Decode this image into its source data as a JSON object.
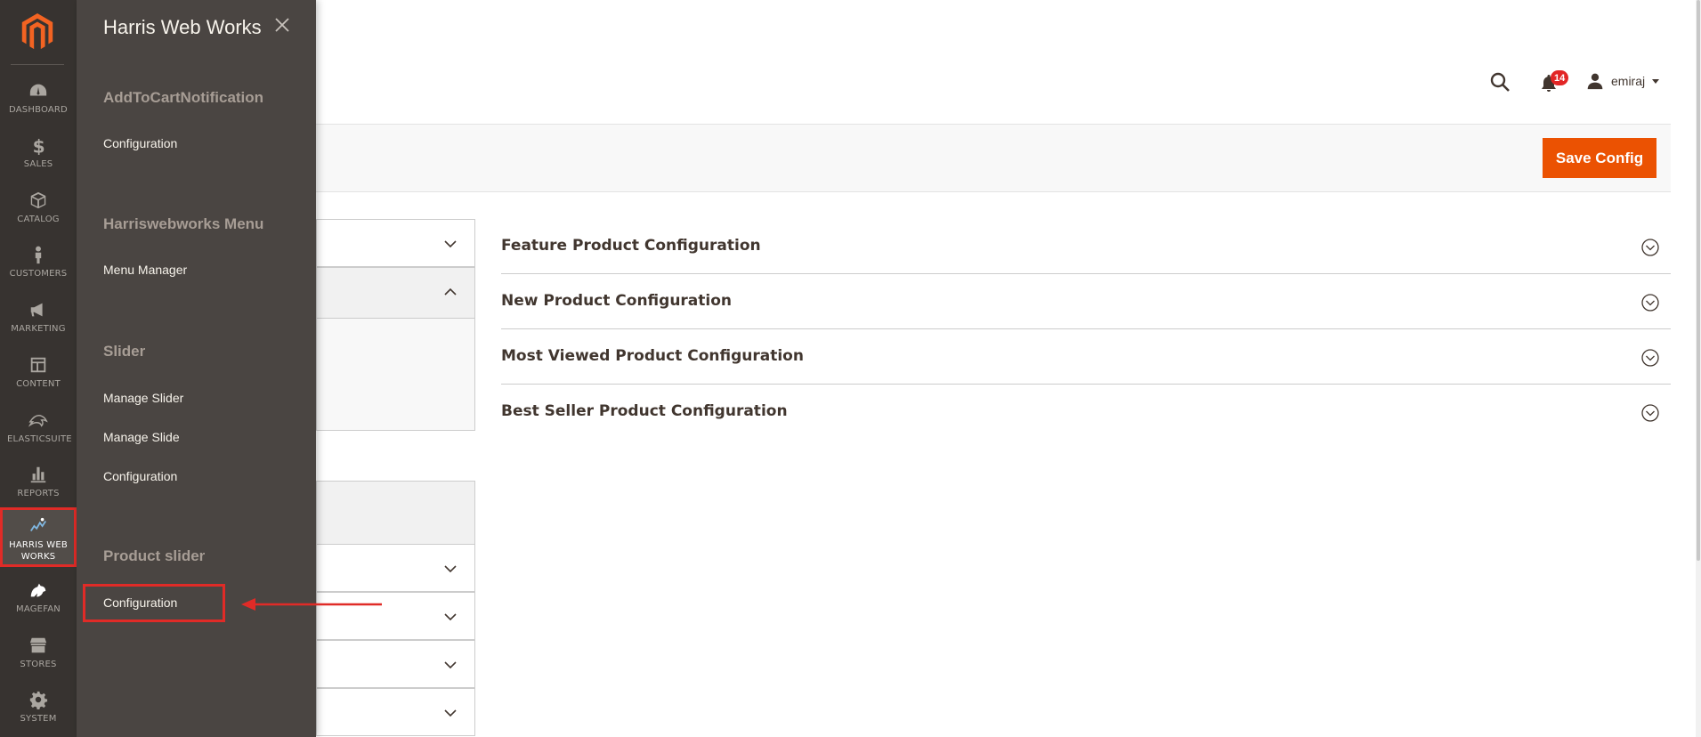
{
  "nav": {
    "items": [
      {
        "label": "Dashboard",
        "icon": "dashboard-icon"
      },
      {
        "label": "Sales",
        "icon": "dollar-icon"
      },
      {
        "label": "Catalog",
        "icon": "box-icon"
      },
      {
        "label": "Customers",
        "icon": "person-icon"
      },
      {
        "label": "Marketing",
        "icon": "megaphone-icon"
      },
      {
        "label": "Content",
        "icon": "layout-icon"
      },
      {
        "label": "Elasticsuite",
        "icon": "elasticsuite-icon"
      },
      {
        "label": "Reports",
        "icon": "bar-chart-icon"
      },
      {
        "label": "Harris Web Works",
        "icon": "harris-icon"
      },
      {
        "label": "Magefan",
        "icon": "magefan-icon"
      },
      {
        "label": "Stores",
        "icon": "store-icon"
      },
      {
        "label": "System",
        "icon": "gear-icon"
      }
    ],
    "active_item": "Harris Web Works"
  },
  "flyout": {
    "title": "Harris Web Works",
    "groups": [
      {
        "title": "AddToCartNotification",
        "links": [
          "Configuration"
        ]
      },
      {
        "title": "Harriswebworks Menu",
        "links": [
          "Menu Manager"
        ]
      },
      {
        "title": "Slider",
        "links": [
          "Manage Slider",
          "Manage Slide",
          "Configuration"
        ]
      },
      {
        "title": "Product slider",
        "links": [
          "Configuration"
        ]
      }
    ]
  },
  "header": {
    "notifications_count": "14",
    "user_name": "emiraj"
  },
  "actions": {
    "save_label": "Save Config"
  },
  "sections": [
    {
      "title": "Feature Product Configuration"
    },
    {
      "title": "New Product Configuration"
    },
    {
      "title": "Most Viewed Product Configuration"
    },
    {
      "title": "Best Seller Product Configuration"
    }
  ],
  "colors": {
    "nav_bg": "#373330",
    "flyout_bg": "#4a4542",
    "accent": "#eb5202",
    "highlight": "#e02b27",
    "badge": "#e22626"
  }
}
